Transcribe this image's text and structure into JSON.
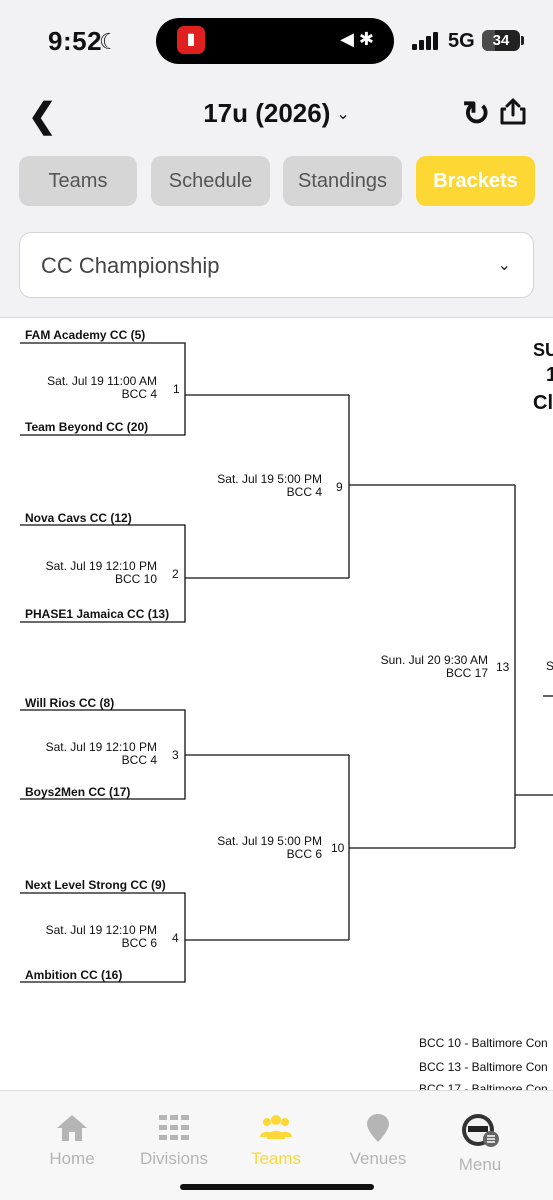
{
  "status_bar": {
    "time": "9:52",
    "network": "5G",
    "battery": "34",
    "battery_level": 0.34
  },
  "header": {
    "title": "17u (2026)"
  },
  "tabs": [
    {
      "label": "Teams",
      "active": false
    },
    {
      "label": "Schedule",
      "active": false
    },
    {
      "label": "Standings",
      "active": false
    },
    {
      "label": "Brackets",
      "active": true
    }
  ],
  "select": {
    "value": "CC Championship"
  },
  "bracket": {
    "teams": [
      "FAM Academy CC (5)",
      "Team Beyond CC (20)",
      "Nova Cavs CC (12)",
      "PHASE1 Jamaica CC (13)",
      "Will Rios CC (8)",
      "Boys2Men CC (17)",
      "Next Level Strong CC (9)",
      "Ambition CC (16)"
    ],
    "games": [
      {
        "num": "1",
        "date": "Sat. Jul 19 11:00 AM",
        "venue": "BCC 4"
      },
      {
        "num": "2",
        "date": "Sat. Jul 19 12:10 PM",
        "venue": "BCC 10"
      },
      {
        "num": "3",
        "date": "Sat. Jul 19 12:10 PM",
        "venue": "BCC 4"
      },
      {
        "num": "4",
        "date": "Sat. Jul 19 12:10 PM",
        "venue": "BCC 6"
      },
      {
        "num": "9",
        "date": "Sat. Jul 19 5:00 PM",
        "venue": "BCC 4"
      },
      {
        "num": "10",
        "date": "Sat. Jul 19 5:00 PM",
        "venue": "BCC 6"
      },
      {
        "num": "13",
        "date": "Sun. Jul 20 9:30 AM",
        "venue": "BCC 17"
      }
    ],
    "edge_fragments": [
      "SU",
      "1",
      "Cl",
      "S"
    ],
    "legend": [
      "BCC 10 - Baltimore Con",
      "BCC 13 - Baltimore Con",
      "BCC 17 - Baltimore Con"
    ]
  },
  "nav": {
    "items": [
      {
        "label": "Home",
        "icon": "home-icon",
        "active": false
      },
      {
        "label": "Divisions",
        "icon": "divisions-icon",
        "active": false
      },
      {
        "label": "Teams",
        "icon": "teams-icon",
        "active": true
      },
      {
        "label": "Venues",
        "icon": "venue-pin-icon",
        "active": false
      },
      {
        "label": "Menu",
        "icon": "menu-logo-icon",
        "active": false
      }
    ]
  },
  "colors": {
    "accent": "#fdd835",
    "tab_inactive": "#d6d6d6",
    "nav_inactive": "#b5b5b5",
    "header_bg": "#f2f2f4"
  }
}
